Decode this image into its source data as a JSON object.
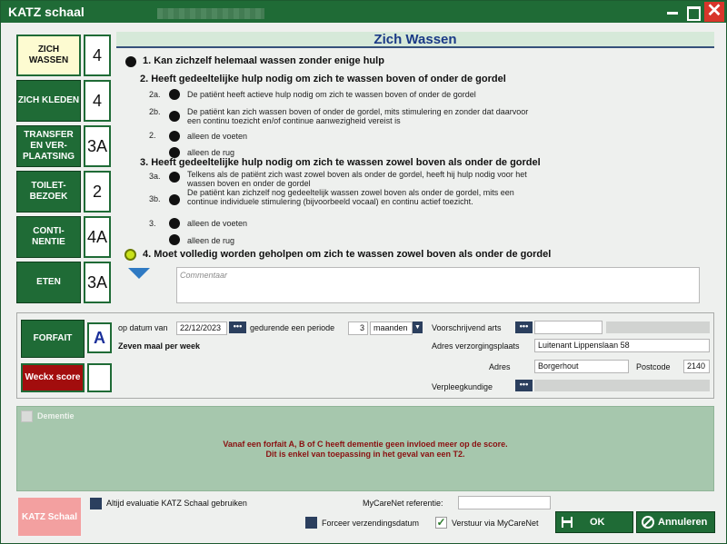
{
  "window": {
    "title": "KATZ schaal"
  },
  "categories": [
    {
      "label": "ZICH WASSEN",
      "score": "4",
      "active": true
    },
    {
      "label": "ZICH KLEDEN",
      "score": "4",
      "active": false
    },
    {
      "label": "TRANSFER EN VER-PLAATSING",
      "score": "3A",
      "active": false
    },
    {
      "label": "TOILET-BEZOEK",
      "score": "2",
      "active": false
    },
    {
      "label": "CONTI-NENTIE",
      "score": "4A",
      "active": false
    },
    {
      "label": "ETEN",
      "score": "3A",
      "active": false
    }
  ],
  "section": {
    "title": "Zich Wassen",
    "option1": "1. Kan zichzelf helemaal wassen zonder enige hulp",
    "option2": "2. Heeft gedeeltelijke hulp nodig om zich te wassen boven of onder de gordel",
    "option2_subs": [
      {
        "code": "2a.",
        "text": "De patiënt heeft actieve hulp nodig om zich te wassen boven of onder de gordel"
      },
      {
        "code": "2b.",
        "text": "De patiënt kan zich wassen boven of onder de gordel, mits stimulering en zonder dat daarvoor een continu toezicht en/of continue aanwezigheid vereist is"
      },
      {
        "code": "2.",
        "text": "alleen de voeten"
      },
      {
        "code": "",
        "text": "alleen de rug"
      }
    ],
    "option3": "3. Heeft gedeeltelijke hulp nodig om zich te wassen zowel boven als onder de gordel",
    "option3_subs": [
      {
        "code": "3a.",
        "text": "Telkens als de patiënt zich wast zowel boven als onder de gordel, heeft hij hulp nodig voor het wassen boven en onder de gordel"
      },
      {
        "code": "3b.",
        "text": "De patiënt kan zichzelf nog gedeeltelijk wassen zowel boven als onder de gordel, mits een continue individuele stimulering (bijvoorbeeld vocaal) en continu actief toezicht."
      },
      {
        "code": "3.",
        "text": "alleen de voeten"
      },
      {
        "code": "",
        "text": "alleen de rug"
      }
    ],
    "option4": "4. Moet volledig worden geholpen om zich te wassen zowel boven als onder de gordel",
    "comment_placeholder": "Commentaar"
  },
  "forfait": {
    "label": "FORFAIT",
    "letter": "A",
    "weckx_label": "Weckx score",
    "weckx_value": "",
    "op_datum_van": "op datum van",
    "date": "22/12/2023",
    "gedurende": "gedurende een periode",
    "period": "3",
    "unit": "maanden",
    "frequency": "Zeven maal per week",
    "voorschrijvend_arts": "Voorschrijvend arts",
    "adres_verzorgingsplaats": "Adres verzorgingsplaats",
    "adres_verzorgingsplaats_value": "Luitenant Lippenslaan 58",
    "adres": "Adres",
    "adres_value": "Borgerhout",
    "postcode": "Postcode",
    "postcode_value": "2140",
    "verpleegkundige": "Verpleegkundige",
    "dots": "•••"
  },
  "dementie": {
    "label": "Dementie",
    "warning_line1": "Vanaf een forfait A, B of C heeft dementie geen invloed meer op de score.",
    "warning_line2": "Dit is enkel van toepassing in het geval van een T2."
  },
  "footer": {
    "katz_button": "KATZ Schaal",
    "altijd_evaluatie": "Altijd evaluatie KATZ Schaal gebruiken",
    "mycarenet_ref": "MyCareNet referentie:",
    "forceer": "Forceer verzendingsdatum",
    "verstuur": "Verstuur via MyCareNet",
    "ok": "OK",
    "annuleren": "Annuleren"
  }
}
